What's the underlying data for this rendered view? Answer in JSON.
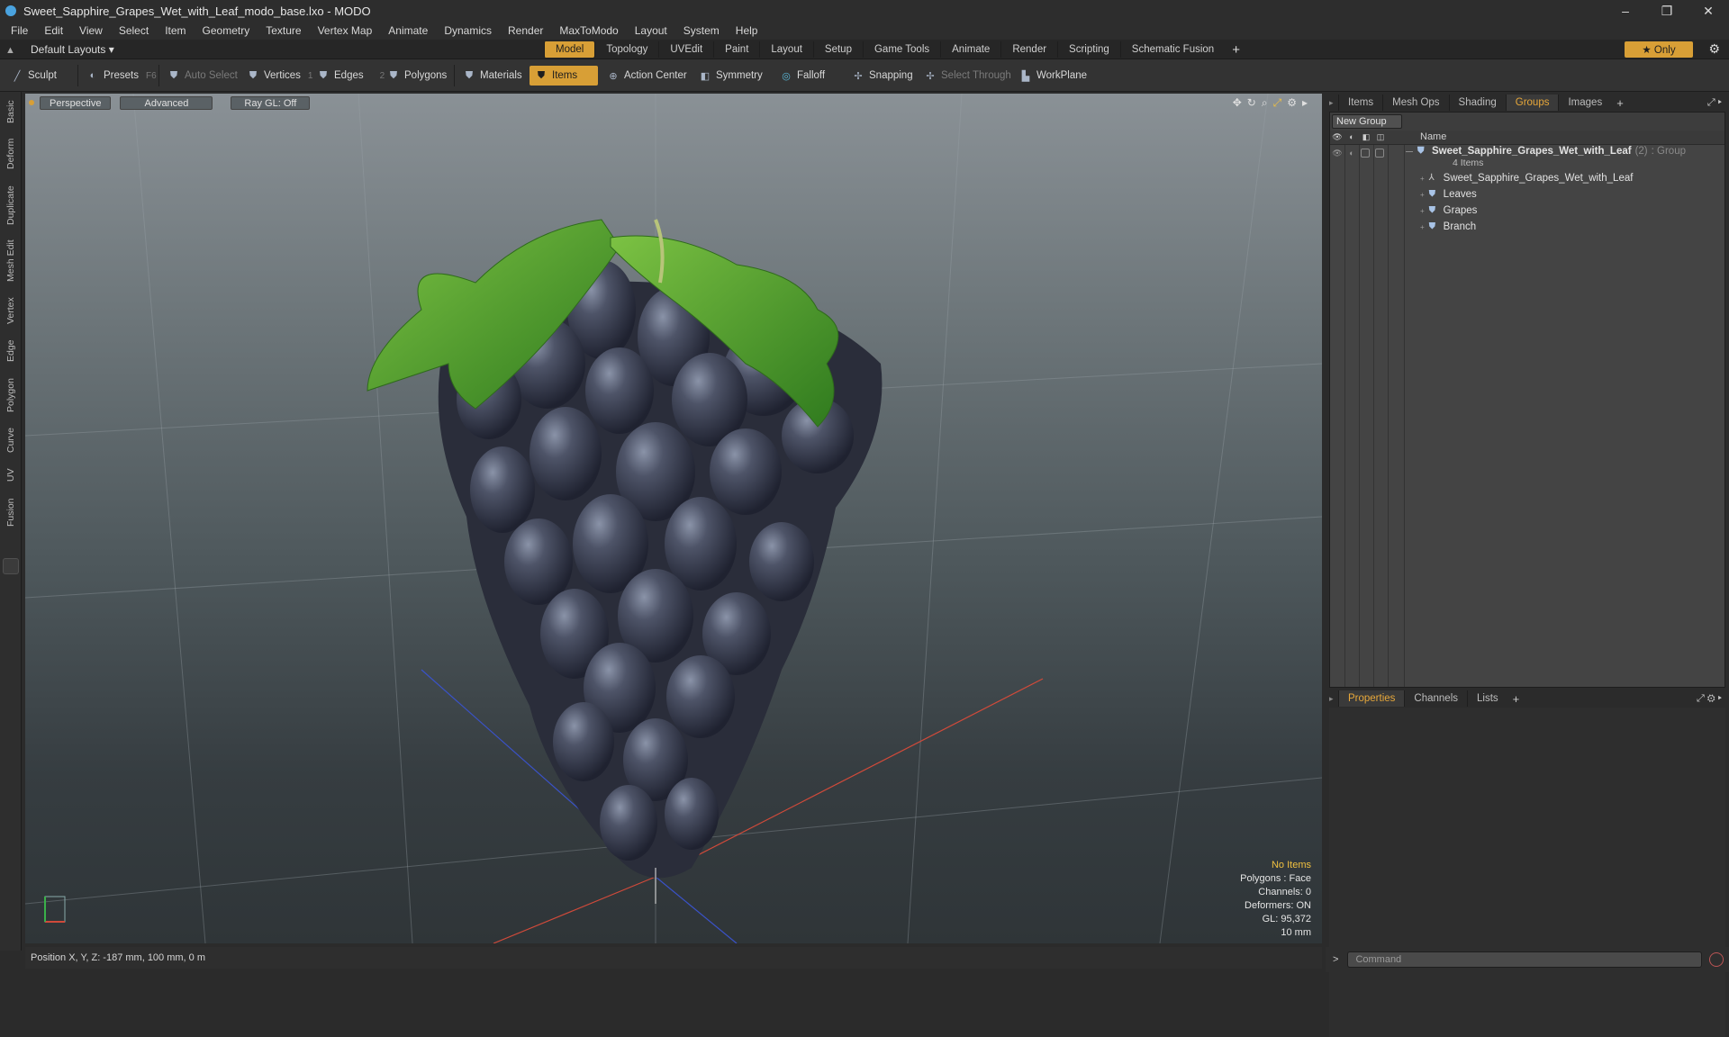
{
  "window": {
    "title": "Sweet_Sapphire_Grapes_Wet_with_Leaf_modo_base.lxo - MODO",
    "minimize": "–",
    "restore": "❐",
    "close": "✕"
  },
  "menu": [
    "File",
    "Edit",
    "View",
    "Select",
    "Item",
    "Geometry",
    "Texture",
    "Vertex Map",
    "Animate",
    "Dynamics",
    "Render",
    "MaxToModo",
    "Layout",
    "System",
    "Help"
  ],
  "layouts": {
    "label": "Default Layouts ▾"
  },
  "tabs": [
    "Model",
    "Topology",
    "UVEdit",
    "Paint",
    "Layout",
    "Setup",
    "Game Tools",
    "Animate",
    "Render",
    "Scripting",
    "Schematic Fusion"
  ],
  "active_tab": "Model",
  "only_label": "★  Only",
  "toolbar": {
    "sculpt": "Sculpt",
    "presets": "Presets",
    "presets_key": "F6",
    "auto_select": "Auto Select",
    "vertices": "Vertices",
    "vertices_count": "1",
    "edges": "Edges",
    "edges_count": "2",
    "polygons": "Polygons",
    "materials": "Materials",
    "items": "Items",
    "action_center": "Action Center",
    "symmetry": "Symmetry",
    "falloff": "Falloff",
    "snapping": "Snapping",
    "select_through": "Select Through",
    "workplane": "WorkPlane"
  },
  "left_tabs": [
    "Basic",
    "Deform",
    "Duplicate",
    "Mesh Edit",
    "Vertex",
    "Edge",
    "Polygon",
    "Curve",
    "UV",
    "Fusion"
  ],
  "viewport": {
    "view": "Perspective",
    "mode": "Advanced",
    "raygl": "Ray GL: Off",
    "info": {
      "items": "No Items",
      "polygons": "Polygons : Face",
      "channels": "Channels: 0",
      "deformers": "Deformers: ON",
      "gl": "GL: 95,372",
      "scale": "10 mm"
    }
  },
  "status": {
    "position": "Position X, Y, Z:  -187 mm, 100 mm, 0 m"
  },
  "right_panel": {
    "top_tabs": [
      "Items",
      "Mesh Ops",
      "Shading",
      "Groups",
      "Images"
    ],
    "active_top_tab": "Groups",
    "new_group": "New Group",
    "column_name": "Name",
    "group": {
      "name": "Sweet_Sapphire_Grapes_Wet_with_Leaf",
      "count": "(2)",
      "type": ": Group",
      "items_label": "4 Items"
    },
    "children": [
      "Sweet_Sapphire_Grapes_Wet_with_Leaf",
      "Leaves",
      "Grapes",
      "Branch"
    ],
    "bottom_tabs": [
      "Properties",
      "Channels",
      "Lists"
    ],
    "active_bottom_tab": "Properties",
    "command_placeholder": "Command"
  },
  "colors": {
    "accent": "#d89f36",
    "highlight_text": "#f0c040"
  }
}
